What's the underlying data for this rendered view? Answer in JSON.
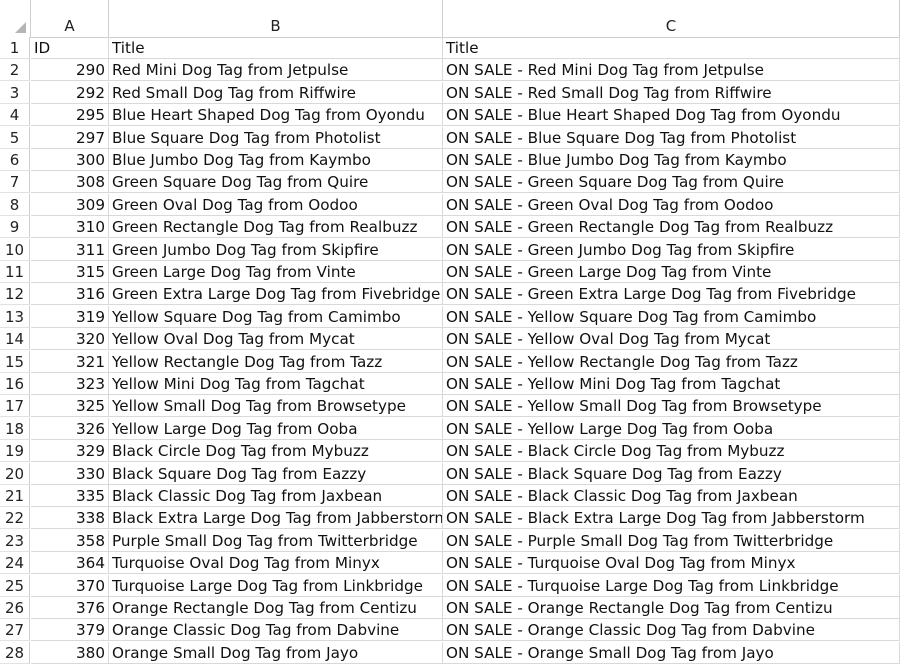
{
  "column_headers": [
    "A",
    "B",
    "C"
  ],
  "rows": [
    {
      "row": "1",
      "a": "ID",
      "b": "Title",
      "c": "Title"
    },
    {
      "row": "2",
      "a": "290",
      "b": "Red Mini Dog Tag from Jetpulse",
      "c": "ON SALE - Red Mini Dog Tag from Jetpulse"
    },
    {
      "row": "3",
      "a": "292",
      "b": "Red Small Dog Tag from Riffwire",
      "c": "ON SALE - Red Small Dog Tag from Riffwire"
    },
    {
      "row": "4",
      "a": "295",
      "b": "Blue Heart Shaped Dog Tag from Oyondu",
      "c": "ON SALE - Blue Heart Shaped Dog Tag from Oyondu"
    },
    {
      "row": "5",
      "a": "297",
      "b": "Blue Square Dog Tag from Photolist",
      "c": "ON SALE - Blue Square Dog Tag from Photolist"
    },
    {
      "row": "6",
      "a": "300",
      "b": "Blue Jumbo Dog Tag from Kaymbo",
      "c": "ON SALE - Blue Jumbo Dog Tag from Kaymbo"
    },
    {
      "row": "7",
      "a": "308",
      "b": "Green Square Dog Tag from Quire",
      "c": "ON SALE - Green Square Dog Tag from Quire"
    },
    {
      "row": "8",
      "a": "309",
      "b": "Green Oval Dog Tag from Oodoo",
      "c": "ON SALE - Green Oval Dog Tag from Oodoo"
    },
    {
      "row": "9",
      "a": "310",
      "b": "Green Rectangle Dog Tag from Realbuzz",
      "c": "ON SALE - Green Rectangle Dog Tag from Realbuzz"
    },
    {
      "row": "10",
      "a": "311",
      "b": "Green Jumbo Dog Tag from Skipfire",
      "c": "ON SALE - Green Jumbo Dog Tag from Skipfire"
    },
    {
      "row": "11",
      "a": "315",
      "b": "Green Large Dog Tag from Vinte",
      "c": "ON SALE - Green Large Dog Tag from Vinte"
    },
    {
      "row": "12",
      "a": "316",
      "b": "Green Extra Large Dog Tag from Fivebridge",
      "c": "ON SALE - Green Extra Large Dog Tag from Fivebridge"
    },
    {
      "row": "13",
      "a": "319",
      "b": "Yellow Square Dog Tag from Camimbo",
      "c": "ON SALE - Yellow Square Dog Tag from Camimbo"
    },
    {
      "row": "14",
      "a": "320",
      "b": "Yellow Oval Dog Tag from Mycat",
      "c": "ON SALE - Yellow Oval Dog Tag from Mycat"
    },
    {
      "row": "15",
      "a": "321",
      "b": "Yellow Rectangle Dog Tag from Tazz",
      "c": "ON SALE - Yellow Rectangle Dog Tag from Tazz"
    },
    {
      "row": "16",
      "a": "323",
      "b": "Yellow Mini Dog Tag from Tagchat",
      "c": "ON SALE - Yellow Mini Dog Tag from Tagchat"
    },
    {
      "row": "17",
      "a": "325",
      "b": "Yellow Small Dog Tag from Browsetype",
      "c": "ON SALE - Yellow Small Dog Tag from Browsetype"
    },
    {
      "row": "18",
      "a": "326",
      "b": "Yellow Large Dog Tag from Ooba",
      "c": "ON SALE - Yellow Large Dog Tag from Ooba"
    },
    {
      "row": "19",
      "a": "329",
      "b": "Black Circle Dog Tag from Mybuzz",
      "c": "ON SALE - Black Circle Dog Tag from Mybuzz"
    },
    {
      "row": "20",
      "a": "330",
      "b": "Black Square Dog Tag from Eazzy",
      "c": "ON SALE - Black Square Dog Tag from Eazzy"
    },
    {
      "row": "21",
      "a": "335",
      "b": "Black Classic Dog Tag from Jaxbean",
      "c": "ON SALE - Black Classic Dog Tag from Jaxbean"
    },
    {
      "row": "22",
      "a": "338",
      "b": "Black Extra Large Dog Tag from Jabberstorm",
      "c": "ON SALE - Black Extra Large Dog Tag from Jabberstorm"
    },
    {
      "row": "23",
      "a": "358",
      "b": "Purple Small Dog Tag from Twitterbridge",
      "c": "ON SALE - Purple Small Dog Tag from Twitterbridge"
    },
    {
      "row": "24",
      "a": "364",
      "b": "Turquoise Oval Dog Tag from Minyx",
      "c": "ON SALE - Turquoise Oval Dog Tag from Minyx"
    },
    {
      "row": "25",
      "a": "370",
      "b": "Turquoise Large Dog Tag from Linkbridge",
      "c": "ON SALE - Turquoise Large Dog Tag from Linkbridge"
    },
    {
      "row": "26",
      "a": "376",
      "b": "Orange Rectangle Dog Tag from Centizu",
      "c": "ON SALE - Orange Rectangle Dog Tag from Centizu"
    },
    {
      "row": "27",
      "a": "379",
      "b": "Orange Classic Dog Tag from Dabvine",
      "c": "ON SALE - Orange Classic Dog Tag from Dabvine"
    },
    {
      "row": "28",
      "a": "380",
      "b": "Orange Small Dog Tag from Jayo",
      "c": "ON SALE - Orange Small Dog Tag from Jayo"
    }
  ]
}
